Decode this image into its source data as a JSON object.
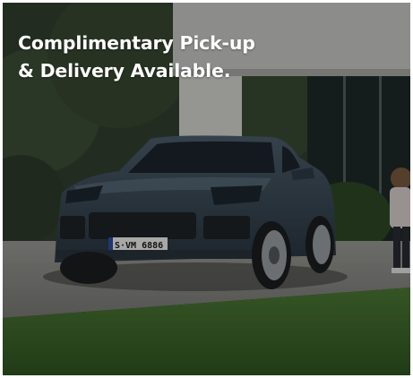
{
  "promo": {
    "headline_line1": "Complimentary Pick-up",
    "headline_line2": "& Delivery Available."
  },
  "vehicle": {
    "plate": "S·VM 6886"
  },
  "colors": {
    "overlay": "#000000",
    "headline": "#ffffff",
    "car_body": "#3b4a57",
    "lawn": "#3f6b2e",
    "driveway": "#8e8e8a"
  }
}
